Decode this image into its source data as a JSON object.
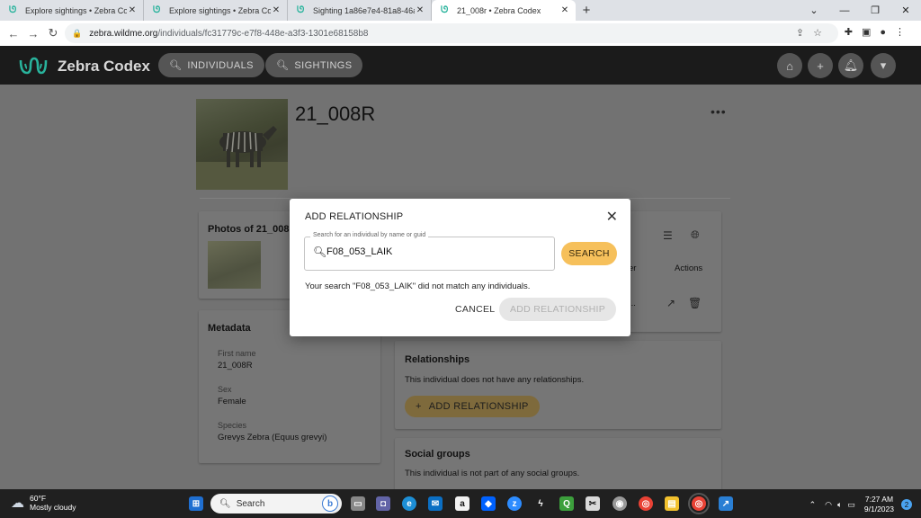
{
  "browser": {
    "tabs": [
      {
        "label": "Explore sightings • Zebra Codex",
        "active": false
      },
      {
        "label": "Explore sightings • Zebra Codex",
        "active": false
      },
      {
        "label": "Sighting 1a86e7e4-81a8-46a6-9...",
        "active": false
      },
      {
        "label": "21_008r • Zebra Codex",
        "active": true
      }
    ],
    "url_host": "zebra.wildme.org",
    "url_path": "/individuals/fc31779c-e7f8-448e-a3f3-1301e68158b8"
  },
  "header": {
    "brand": "Zebra Codex",
    "individuals_label": "INDIVIDUALS",
    "sightings_label": "SIGHTINGS",
    "accent_color": "#29b39c"
  },
  "individual": {
    "name": "21_008R"
  },
  "photos_card": {
    "title": "Photos of 21_008R"
  },
  "metadata": {
    "title": "Metadata",
    "fields": [
      {
        "label": "First name",
        "value": "21_008R"
      },
      {
        "label": "Sex",
        "value": "Female"
      },
      {
        "label": "Species",
        "value": "Grevys Zebra (Equus grevyi)"
      }
    ]
  },
  "sightings_table": {
    "col_partial": "er",
    "actions_header": "Actions",
    "row_partial": "..."
  },
  "relationships": {
    "title": "Relationships",
    "empty_text": "This individual does not have any relationships.",
    "add_label": "ADD RELATIONSHIP"
  },
  "social_groups": {
    "title": "Social groups",
    "empty_text": "This individual is not part of any social groups."
  },
  "modal": {
    "title": "ADD RELATIONSHIP",
    "field_label": "Search for an individual by name or guid",
    "field_value": "F08_053_LAIK",
    "search_label": "SEARCH",
    "no_match_text": "Your search \"F08_053_LAIK\" did not match any individuals.",
    "cancel_label": "CANCEL",
    "add_label": "ADD RELATIONSHIP",
    "search_button_color": "#f6c05b"
  },
  "taskbar": {
    "temperature": "60°F",
    "weather": "Mostly cloudy",
    "search_placeholder": "Search",
    "time": "7:27 AM",
    "date": "9/1/2023",
    "notifications": "2"
  }
}
